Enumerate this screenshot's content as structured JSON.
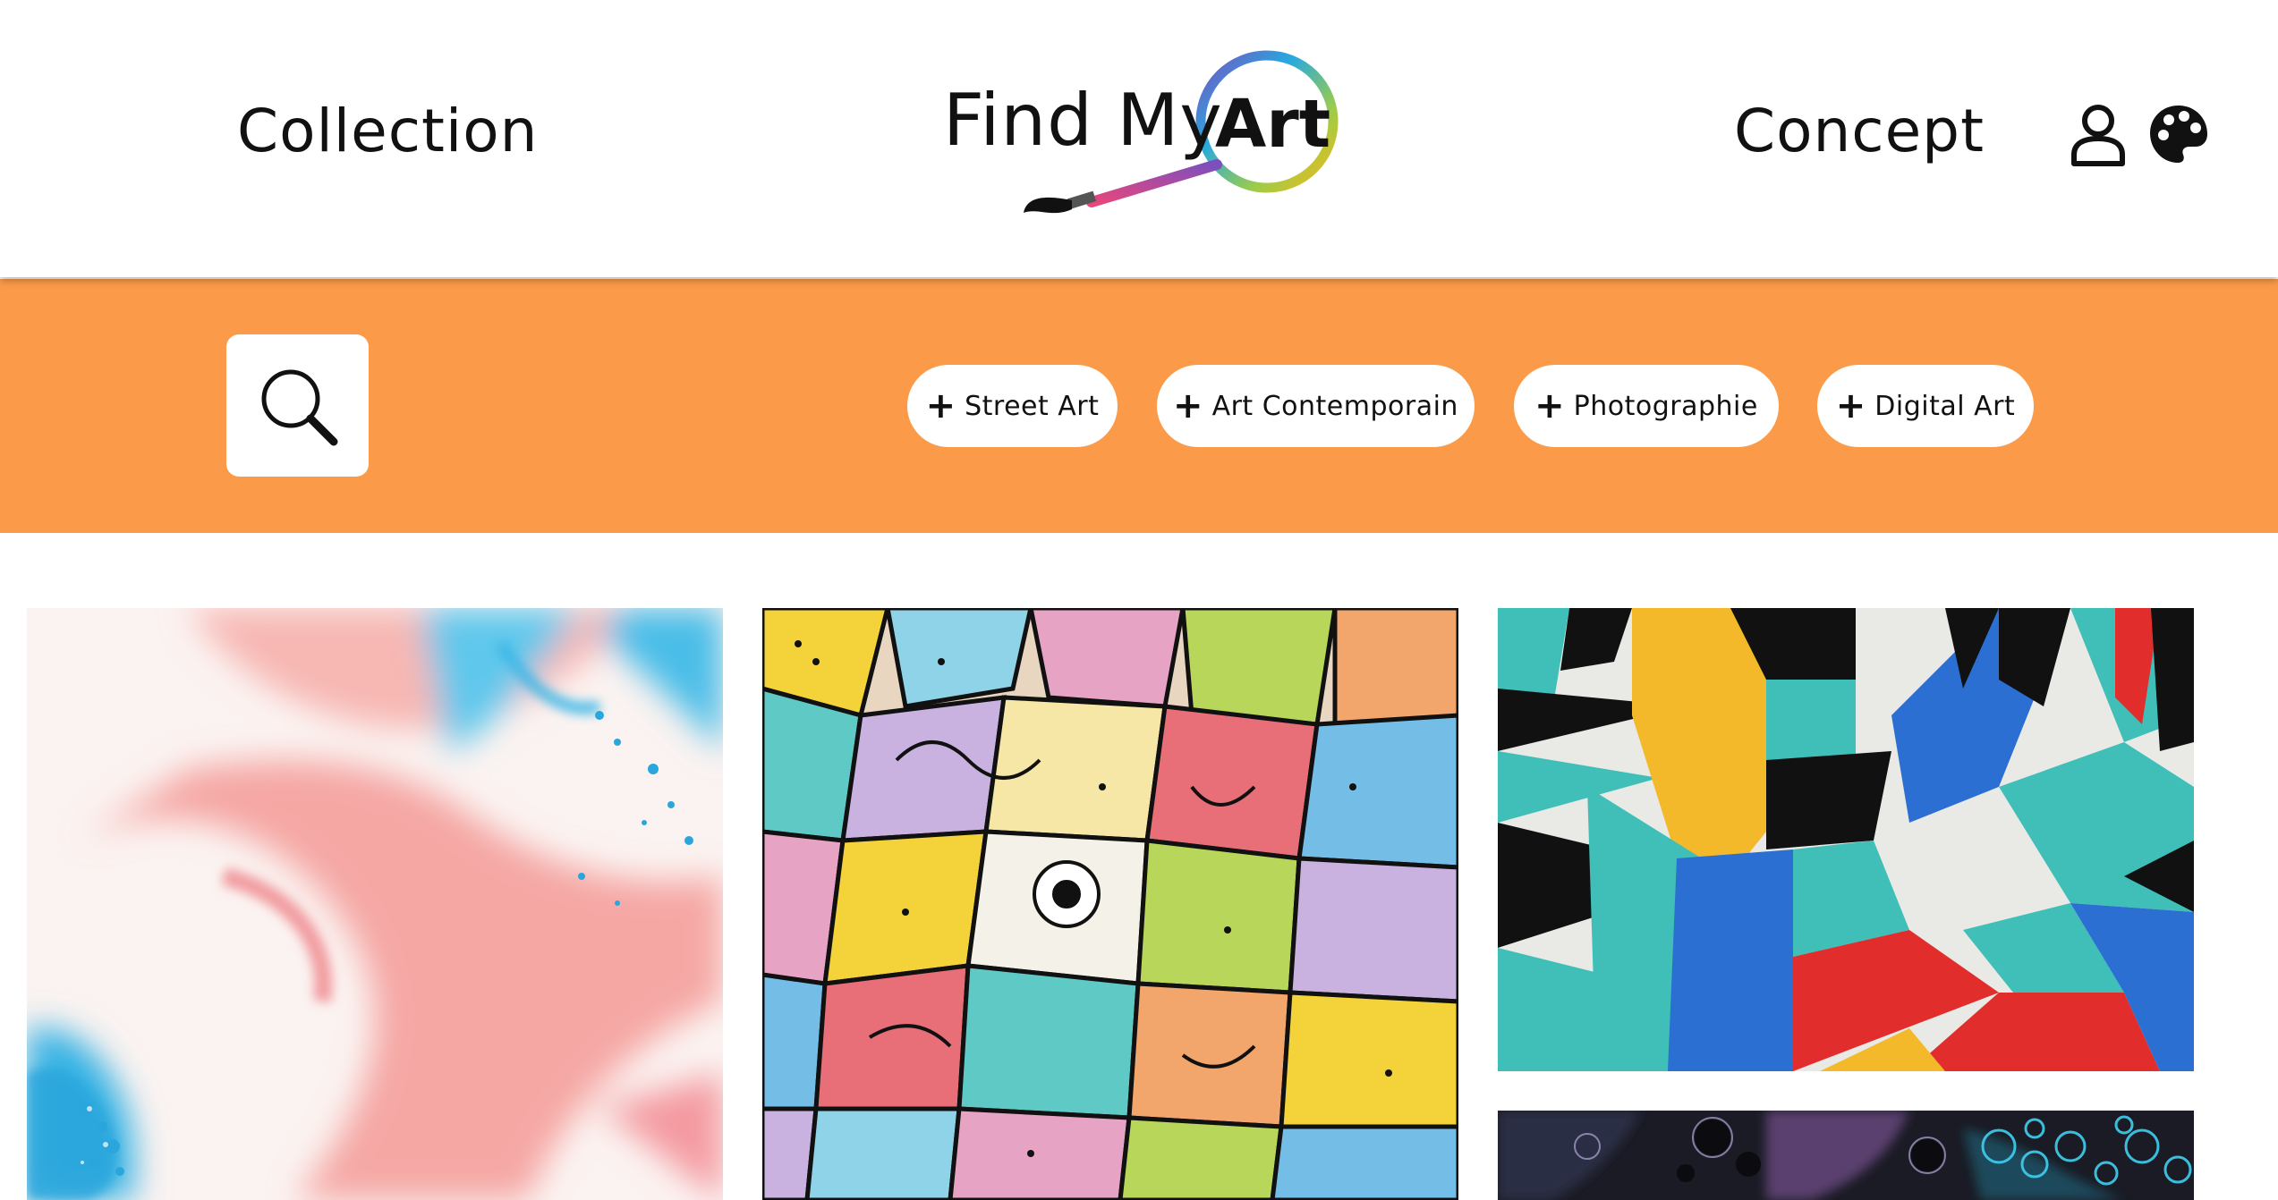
{
  "header": {
    "nav": {
      "collection_label": "Collection",
      "concept_label": "Concept"
    },
    "logo": {
      "text_main": "Find My",
      "text_accent": "Art",
      "icon": "magnifier-brush-logo"
    },
    "user_icon": "user-icon",
    "palette_icon": "palette-icon"
  },
  "filters": {
    "search_icon": "search-icon",
    "background_color": "#fb9b49",
    "chips": [
      {
        "label": "Street Art",
        "icon": "plus-icon"
      },
      {
        "label": "Art Contemporain",
        "icon": "plus-icon"
      },
      {
        "label": "Photographie",
        "icon": "plus-icon"
      },
      {
        "label": "Digital Art",
        "icon": "plus-icon"
      }
    ]
  },
  "gallery": {
    "artworks": [
      {
        "subject": "pink and blue fluid acrylic pour"
      },
      {
        "subject": "colorful doodle graffiti letters"
      },
      {
        "subject": "abstract geometric mural teal yellow red black"
      },
      {
        "subject": "dark fluid art with cyan cells"
      }
    ]
  },
  "colors": {
    "accent_orange": "#fb9b49",
    "logo_gradient": [
      "#e8467c",
      "#7b4fbf",
      "#26a9e0",
      "#f5b915"
    ]
  }
}
